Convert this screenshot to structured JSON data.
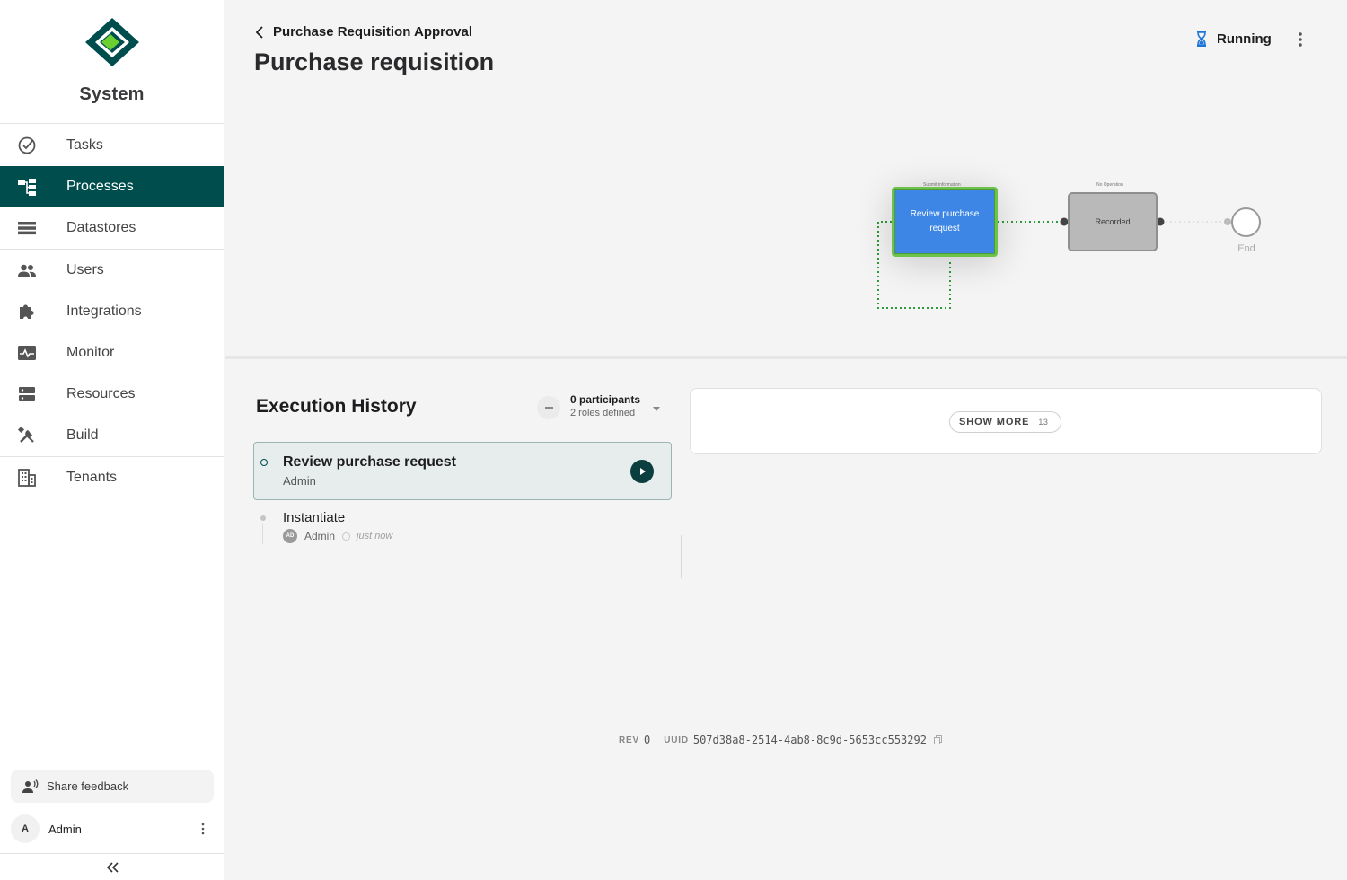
{
  "brand": {
    "name": "System",
    "logo_colors": {
      "outer": "#004d4d",
      "inner": "#6bd02f"
    }
  },
  "sidebar": {
    "items": [
      {
        "label": "Tasks",
        "icon": "check-circle-icon",
        "active": false
      },
      {
        "label": "Processes",
        "icon": "process-tree-icon",
        "active": true
      },
      {
        "label": "Datastores",
        "icon": "datastore-icon",
        "active": false
      },
      {
        "label": "Users",
        "icon": "users-icon",
        "active": false
      },
      {
        "label": "Integrations",
        "icon": "puzzle-icon",
        "active": false
      },
      {
        "label": "Monitor",
        "icon": "monitor-icon",
        "active": false
      },
      {
        "label": "Resources",
        "icon": "resources-icon",
        "active": false
      },
      {
        "label": "Build",
        "icon": "tools-icon",
        "active": false
      },
      {
        "label": "Tenants",
        "icon": "building-icon",
        "active": false
      }
    ],
    "feedback_label": "Share feedback",
    "user": {
      "initial": "A",
      "name": "Admin"
    }
  },
  "header": {
    "breadcrumb": "Purchase Requisition Approval",
    "title": "Purchase requisition",
    "status": "Running"
  },
  "diagram": {
    "review_node": {
      "label": "Review purchase request",
      "caption": "Submit information"
    },
    "recorded_node": {
      "label": "Recorded",
      "caption": "No Operation"
    },
    "end_label": "End",
    "colors": {
      "active_fill": "#3d86e5",
      "active_border": "#6cc24a",
      "flow": "#2e9a3b"
    }
  },
  "execution": {
    "title": "Execution History",
    "participants": "0 participants",
    "roles": "2 roles defined",
    "current_task": {
      "name": "Review purchase request",
      "assignee": "Admin"
    },
    "history": [
      {
        "name": "Instantiate",
        "avatar": "AD",
        "user": "Admin",
        "time": "just now"
      }
    ]
  },
  "detail": {
    "show_more_label": "SHOW MORE",
    "show_more_count": "13"
  },
  "footer": {
    "rev_label": "REV",
    "rev_value": "0",
    "uuid_label": "UUID",
    "uuid_value": "507d38a8-2514-4ab8-8c9d-5653cc553292"
  }
}
